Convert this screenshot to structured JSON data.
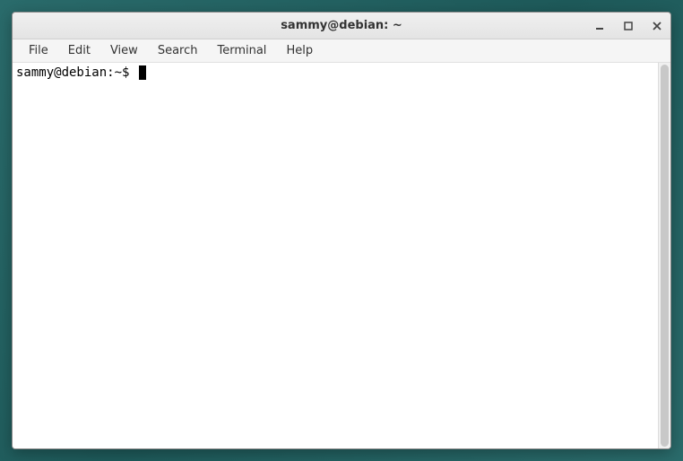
{
  "window": {
    "title": "sammy@debian: ~"
  },
  "menubar": {
    "items": [
      {
        "label": "File"
      },
      {
        "label": "Edit"
      },
      {
        "label": "View"
      },
      {
        "label": "Search"
      },
      {
        "label": "Terminal"
      },
      {
        "label": "Help"
      }
    ]
  },
  "terminal": {
    "prompt": "sammy@debian:~$ "
  }
}
